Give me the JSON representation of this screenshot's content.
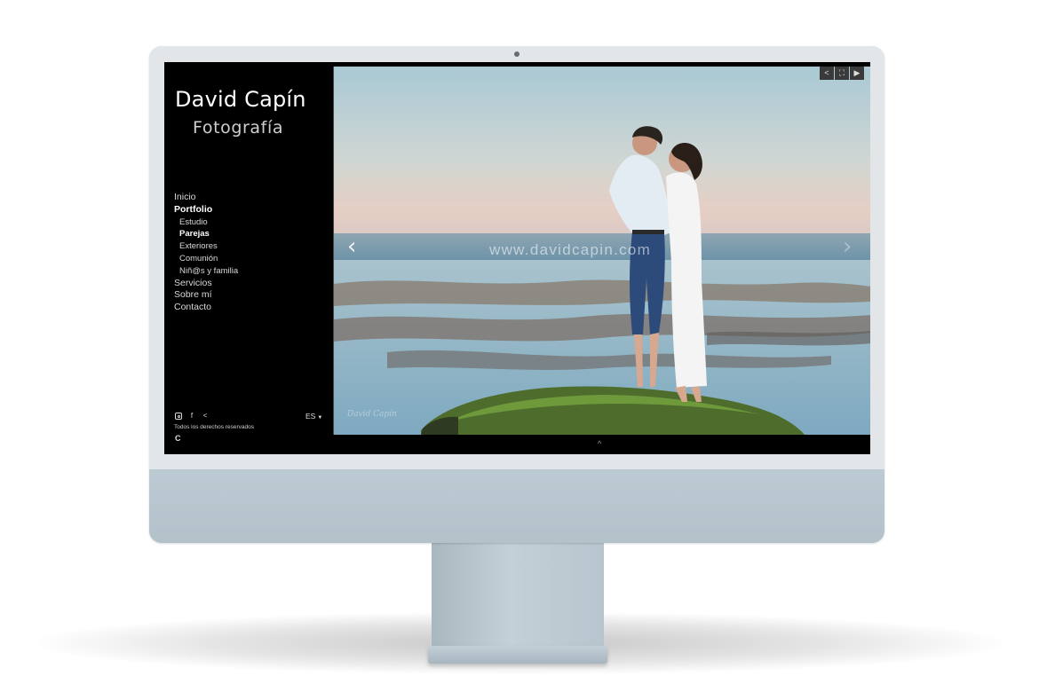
{
  "site": {
    "name": "David Capín",
    "subtitle": "Fotografía"
  },
  "nav": {
    "items": [
      {
        "label": "Inicio",
        "level": 0,
        "active": false
      },
      {
        "label": "Portfolio",
        "level": 0,
        "active": true
      },
      {
        "label": "Estudio",
        "level": 1,
        "active": false
      },
      {
        "label": "Parejas",
        "level": 1,
        "active": true
      },
      {
        "label": "Exteriores",
        "level": 1,
        "active": false
      },
      {
        "label": "Comunión",
        "level": 1,
        "active": false
      },
      {
        "label": "Niñ@s y familia",
        "level": 1,
        "active": false
      },
      {
        "label": "Servicios",
        "level": 0,
        "active": false
      },
      {
        "label": "Sobre mí",
        "level": 0,
        "active": false
      },
      {
        "label": "Contacto",
        "level": 0,
        "active": false
      }
    ]
  },
  "footer": {
    "social_icons": [
      "instagram-icon",
      "facebook-icon",
      "share-icon"
    ],
    "rights": "Todos los derechos reservados",
    "logo_glyph": "C",
    "language": "ES"
  },
  "gallery": {
    "watermark": "www.davidcapin.com",
    "signature": "David Capín",
    "toolbar_icons": [
      "share-icon",
      "fullscreen-icon",
      "play-icon"
    ],
    "prev_glyph": "‹",
    "next_glyph": "›",
    "scroll_up_glyph": "^"
  },
  "colors": {
    "screen_bg": "#000000",
    "monitor_body": "#b9c7d0",
    "monitor_bezel": "#e3e6e8"
  }
}
